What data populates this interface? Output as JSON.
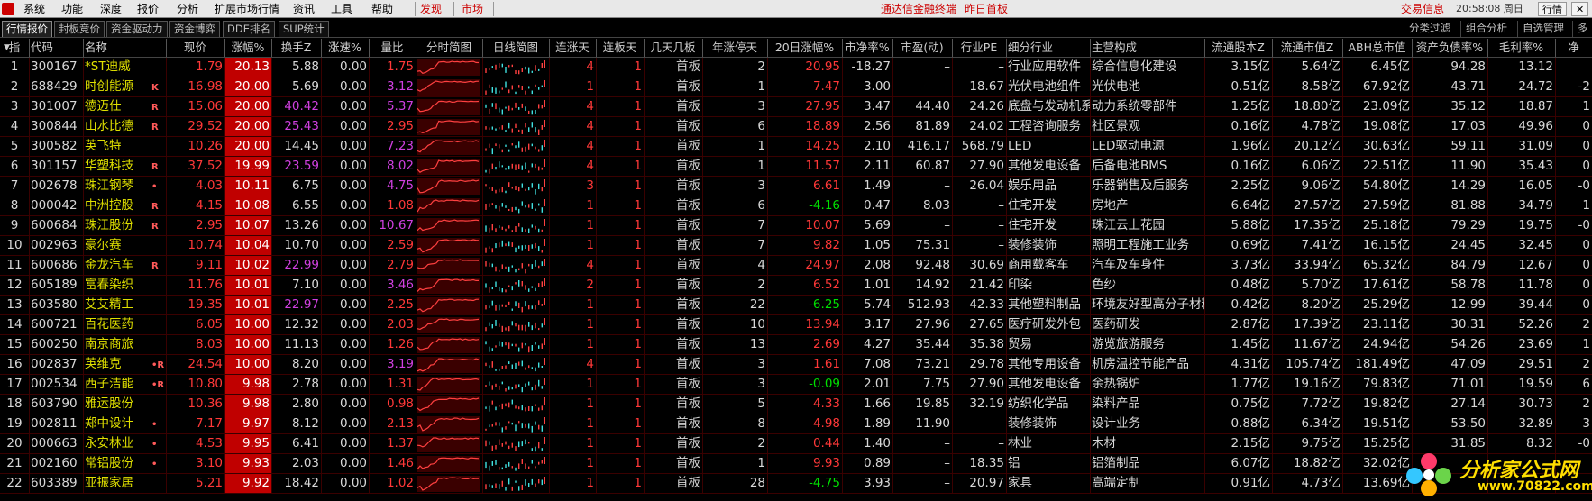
{
  "menu": {
    "items": [
      "系统",
      "功能",
      "深度",
      "报价",
      "分析",
      "扩展市场行情",
      "资讯",
      "工具",
      "帮助"
    ],
    "red_items": [
      "发现",
      "市场"
    ],
    "notice1": "通达信金融终端",
    "notice2": "昨日首板",
    "trade": "交易信息",
    "time": "20:58:08 周日",
    "btn_quote": "行情",
    "btn_close": "✕"
  },
  "tabs": [
    "行情报价",
    "封板竞价",
    "资金驱动力",
    "资金博弈",
    "DDE排名",
    "SUP统计"
  ],
  "right_tabs": [
    "分类过滤",
    "组合分析",
    "自选管理",
    "多"
  ],
  "columns": [
    "指",
    "代码",
    "名称",
    "现价",
    "涨幅%",
    "换手Z",
    "涨速%",
    "量比",
    "分时简图",
    "日线简图",
    "连涨天",
    "连板天",
    "几天几板",
    "年涨停天",
    "20日涨幅%",
    "市净率%",
    "市盈(动)",
    "行业PE",
    "细分行业",
    "主营构成",
    "流通股本Z",
    "流通市值Z",
    "ABH总市值",
    "资产负债率%",
    "毛利率%",
    "净"
  ],
  "rows": [
    {
      "n": "1",
      "code": "300167",
      "name": "*ST迪威",
      "flag": "",
      "price": "1.79",
      "pct": "20.13",
      "turn": "5.88",
      "spd": "0.00",
      "vr": "1.75",
      "ld": "4",
      "lb": "1",
      "board": "首板",
      "ytd": "2",
      "p20": "20.95",
      "p20c": "up",
      "pb": "-18.27",
      "pe": "–",
      "ipe": "–",
      "ind": "行业应用软件",
      "main": "综合信息化建设",
      "fs": "3.15亿",
      "fv": "5.64亿",
      "tv": "6.45亿",
      "dr": "94.28",
      "gm": "13.12",
      "x": ""
    },
    {
      "n": "2",
      "code": "688429",
      "name": "时创能源",
      "flag": "K",
      "price": "16.98",
      "pct": "20.00",
      "turn": "5.69",
      "spd": "0.00",
      "vr": "3.12",
      "ld": "1",
      "lb": "1",
      "board": "首板",
      "ytd": "1",
      "p20": "7.47",
      "p20c": "up",
      "pb": "3.00",
      "pe": "–",
      "ipe": "18.67",
      "ind": "光伏电池组件",
      "main": "光伏电池",
      "fs": "0.51亿",
      "fv": "8.58亿",
      "tv": "67.92亿",
      "dr": "43.71",
      "gm": "24.72",
      "x": "-2"
    },
    {
      "n": "3",
      "code": "301007",
      "name": "德迈仕",
      "flag": "R",
      "price": "15.06",
      "pct": "20.00",
      "turn": "40.42",
      "spd": "0.00",
      "vr": "5.37",
      "ld": "4",
      "lb": "1",
      "board": "首板",
      "ytd": "3",
      "p20": "27.95",
      "p20c": "up",
      "pb": "3.47",
      "pe": "44.40",
      "ipe": "24.26",
      "ind": "底盘与发动机系",
      "main": "动力系统零部件",
      "fs": "1.25亿",
      "fv": "18.80亿",
      "tv": "23.09亿",
      "dr": "35.12",
      "gm": "18.87",
      "x": "1"
    },
    {
      "n": "4",
      "code": "300844",
      "name": "山水比德",
      "flag": "R",
      "price": "29.52",
      "pct": "20.00",
      "turn": "25.43",
      "spd": "0.00",
      "vr": "2.95",
      "ld": "4",
      "lb": "1",
      "board": "首板",
      "ytd": "6",
      "p20": "18.89",
      "p20c": "up",
      "pb": "2.56",
      "pe": "81.89",
      "ipe": "24.02",
      "ind": "工程咨询服务",
      "main": "社区景观",
      "fs": "0.16亿",
      "fv": "4.78亿",
      "tv": "19.08亿",
      "dr": "17.03",
      "gm": "49.96",
      "x": "0"
    },
    {
      "n": "5",
      "code": "300582",
      "name": "英飞特",
      "flag": "",
      "price": "10.26",
      "pct": "20.00",
      "turn": "14.45",
      "spd": "0.00",
      "vr": "7.23",
      "ld": "4",
      "lb": "1",
      "board": "首板",
      "ytd": "1",
      "p20": "14.25",
      "p20c": "up",
      "pb": "2.10",
      "pe": "416.17",
      "ipe": "568.79",
      "ind": "LED",
      "main": "LED驱动电源",
      "fs": "1.96亿",
      "fv": "20.12亿",
      "tv": "30.63亿",
      "dr": "59.11",
      "gm": "31.09",
      "x": "0"
    },
    {
      "n": "6",
      "code": "301157",
      "name": "华塑科技",
      "flag": "R",
      "price": "37.52",
      "pct": "19.99",
      "turn": "23.59",
      "spd": "0.00",
      "vr": "8.02",
      "ld": "4",
      "lb": "1",
      "board": "首板",
      "ytd": "1",
      "p20": "11.57",
      "p20c": "up",
      "pb": "2.11",
      "pe": "60.87",
      "ipe": "27.90",
      "ind": "其他发电设备",
      "main": "后备电池BMS",
      "fs": "0.16亿",
      "fv": "6.06亿",
      "tv": "22.51亿",
      "dr": "11.90",
      "gm": "35.43",
      "x": "0"
    },
    {
      "n": "7",
      "code": "002678",
      "name": "珠江钢琴",
      "flag": "•",
      "price": "4.03",
      "pct": "10.11",
      "turn": "6.75",
      "spd": "0.00",
      "vr": "4.75",
      "ld": "3",
      "lb": "1",
      "board": "首板",
      "ytd": "3",
      "p20": "6.61",
      "p20c": "up",
      "pb": "1.49",
      "pe": "–",
      "ipe": "26.04",
      "ind": "娱乐用品",
      "main": "乐器销售及后服务",
      "fs": "2.25亿",
      "fv": "9.06亿",
      "tv": "54.80亿",
      "dr": "14.29",
      "gm": "16.05",
      "x": "-0"
    },
    {
      "n": "8",
      "code": "000042",
      "name": "中洲控股",
      "flag": "R",
      "price": "4.15",
      "pct": "10.08",
      "turn": "6.55",
      "spd": "0.00",
      "vr": "1.08",
      "ld": "1",
      "lb": "1",
      "board": "首板",
      "ytd": "6",
      "p20": "-4.16",
      "p20c": "dn",
      "pb": "0.47",
      "pe": "8.03",
      "ipe": "–",
      "ind": "住宅开发",
      "main": "房地产",
      "fs": "6.64亿",
      "fv": "27.57亿",
      "tv": "27.59亿",
      "dr": "81.88",
      "gm": "34.79",
      "x": "1"
    },
    {
      "n": "9",
      "code": "600684",
      "name": "珠江股份",
      "flag": "R",
      "price": "2.95",
      "pct": "10.07",
      "turn": "13.26",
      "spd": "0.00",
      "vr": "10.67",
      "ld": "1",
      "lb": "1",
      "board": "首板",
      "ytd": "7",
      "p20": "10.07",
      "p20c": "up",
      "pb": "5.69",
      "pe": "–",
      "ipe": "–",
      "ind": "住宅开发",
      "main": "珠江云上花园",
      "fs": "5.88亿",
      "fv": "17.35亿",
      "tv": "25.18亿",
      "dr": "79.29",
      "gm": "19.75",
      "x": "-0"
    },
    {
      "n": "10",
      "code": "002963",
      "name": "豪尔赛",
      "flag": "",
      "price": "10.74",
      "pct": "10.04",
      "turn": "10.70",
      "spd": "0.00",
      "vr": "2.59",
      "ld": "1",
      "lb": "1",
      "board": "首板",
      "ytd": "7",
      "p20": "9.82",
      "p20c": "up",
      "pb": "1.05",
      "pe": "75.31",
      "ipe": "–",
      "ind": "装修装饰",
      "main": "照明工程施工业务",
      "fs": "0.69亿",
      "fv": "7.41亿",
      "tv": "16.15亿",
      "dr": "24.45",
      "gm": "32.45",
      "x": "0"
    },
    {
      "n": "11",
      "code": "600686",
      "name": "金龙汽车",
      "flag": "R",
      "price": "9.11",
      "pct": "10.02",
      "turn": "22.99",
      "spd": "0.00",
      "vr": "2.79",
      "ld": "4",
      "lb": "1",
      "board": "首板",
      "ytd": "4",
      "p20": "24.97",
      "p20c": "up",
      "pb": "2.08",
      "pe": "92.48",
      "ipe": "30.69",
      "ind": "商用载客车",
      "main": "汽车及车身件",
      "fs": "3.73亿",
      "fv": "33.94亿",
      "tv": "65.32亿",
      "dr": "84.79",
      "gm": "12.67",
      "x": "0"
    },
    {
      "n": "12",
      "code": "605189",
      "name": "富春染织",
      "flag": "",
      "price": "11.76",
      "pct": "10.01",
      "turn": "7.10",
      "spd": "0.00",
      "vr": "3.46",
      "ld": "2",
      "lb": "1",
      "board": "首板",
      "ytd": "2",
      "p20": "6.52",
      "p20c": "up",
      "pb": "1.01",
      "pe": "14.92",
      "ipe": "21.42",
      "ind": "印染",
      "main": "色纱",
      "fs": "0.48亿",
      "fv": "5.70亿",
      "tv": "17.61亿",
      "dr": "58.78",
      "gm": "11.78",
      "x": "0"
    },
    {
      "n": "13",
      "code": "603580",
      "name": "艾艾精工",
      "flag": "",
      "price": "19.35",
      "pct": "10.01",
      "turn": "22.97",
      "spd": "0.00",
      "vr": "2.25",
      "ld": "1",
      "lb": "1",
      "board": "首板",
      "ytd": "22",
      "p20": "-6.25",
      "p20c": "dn",
      "pb": "5.74",
      "pe": "512.93",
      "ipe": "42.33",
      "ind": "其他塑料制品",
      "main": "环境友好型高分子材料",
      "fs": "0.42亿",
      "fv": "8.20亿",
      "tv": "25.29亿",
      "dr": "12.99",
      "gm": "39.44",
      "x": "0"
    },
    {
      "n": "14",
      "code": "600721",
      "name": "百花医药",
      "flag": "",
      "price": "6.05",
      "pct": "10.00",
      "turn": "12.32",
      "spd": "0.00",
      "vr": "2.03",
      "ld": "1",
      "lb": "1",
      "board": "首板",
      "ytd": "10",
      "p20": "13.94",
      "p20c": "up",
      "pb": "3.17",
      "pe": "27.96",
      "ipe": "27.65",
      "ind": "医疗研发外包",
      "main": "医药研发",
      "fs": "2.87亿",
      "fv": "17.39亿",
      "tv": "23.11亿",
      "dr": "30.31",
      "gm": "52.26",
      "x": "2"
    },
    {
      "n": "15",
      "code": "600250",
      "name": "南京商旅",
      "flag": "",
      "price": "8.03",
      "pct": "10.00",
      "turn": "11.13",
      "spd": "0.00",
      "vr": "1.26",
      "ld": "1",
      "lb": "1",
      "board": "首板",
      "ytd": "13",
      "p20": "2.69",
      "p20c": "up",
      "pb": "4.27",
      "pe": "35.44",
      "ipe": "35.38",
      "ind": "贸易",
      "main": "游览旅游服务",
      "fs": "1.45亿",
      "fv": "11.67亿",
      "tv": "24.94亿",
      "dr": "54.26",
      "gm": "23.69",
      "x": "1"
    },
    {
      "n": "16",
      "code": "002837",
      "name": "英维克",
      "flag": "•R",
      "price": "24.54",
      "pct": "10.00",
      "turn": "8.20",
      "spd": "0.00",
      "vr": "3.19",
      "ld": "4",
      "lb": "1",
      "board": "首板",
      "ytd": "3",
      "p20": "1.61",
      "p20c": "up",
      "pb": "7.08",
      "pe": "73.21",
      "ipe": "29.78",
      "ind": "其他专用设备",
      "main": "机房温控节能产品",
      "fs": "4.31亿",
      "fv": "105.74亿",
      "tv": "181.49亿",
      "dr": "47.09",
      "gm": "29.51",
      "x": "2"
    },
    {
      "n": "17",
      "code": "002534",
      "name": "西子洁能",
      "flag": "•R",
      "price": "10.80",
      "pct": "9.98",
      "turn": "2.78",
      "spd": "0.00",
      "vr": "1.31",
      "ld": "1",
      "lb": "1",
      "board": "首板",
      "ytd": "3",
      "p20": "-0.09",
      "p20c": "dn",
      "pb": "2.01",
      "pe": "7.75",
      "ipe": "27.90",
      "ind": "其他发电设备",
      "main": "余热锅炉",
      "fs": "1.77亿",
      "fv": "19.16亿",
      "tv": "79.83亿",
      "dr": "71.01",
      "gm": "19.59",
      "x": "6"
    },
    {
      "n": "18",
      "code": "603790",
      "name": "雅运股份",
      "flag": "",
      "price": "10.36",
      "pct": "9.98",
      "turn": "2.80",
      "spd": "0.00",
      "vr": "0.98",
      "ld": "1",
      "lb": "1",
      "board": "首板",
      "ytd": "5",
      "p20": "4.33",
      "p20c": "up",
      "pb": "1.66",
      "pe": "19.85",
      "ipe": "32.19",
      "ind": "纺织化学品",
      "main": "染料产品",
      "fs": "0.75亿",
      "fv": "7.72亿",
      "tv": "19.82亿",
      "dr": "27.14",
      "gm": "30.73",
      "x": "2"
    },
    {
      "n": "19",
      "code": "002811",
      "name": "郑中设计",
      "flag": "•",
      "price": "7.17",
      "pct": "9.97",
      "turn": "8.12",
      "spd": "0.00",
      "vr": "2.13",
      "ld": "1",
      "lb": "1",
      "board": "首板",
      "ytd": "8",
      "p20": "4.98",
      "p20c": "up",
      "pb": "1.89",
      "pe": "11.90",
      "ipe": "–",
      "ind": "装修装饰",
      "main": "设计业务",
      "fs": "0.88亿",
      "fv": "6.34亿",
      "tv": "19.51亿",
      "dr": "53.50",
      "gm": "32.89",
      "x": "3"
    },
    {
      "n": "20",
      "code": "000663",
      "name": "永安林业",
      "flag": "•",
      "price": "4.53",
      "pct": "9.95",
      "turn": "6.41",
      "spd": "0.00",
      "vr": "1.37",
      "ld": "1",
      "lb": "1",
      "board": "首板",
      "ytd": "2",
      "p20": "0.44",
      "p20c": "up",
      "pb": "1.40",
      "pe": "–",
      "ipe": "–",
      "ind": "林业",
      "main": "木材",
      "fs": "2.15亿",
      "fv": "9.75亿",
      "tv": "15.25亿",
      "dr": "31.85",
      "gm": "8.32",
      "x": "-0"
    },
    {
      "n": "21",
      "code": "002160",
      "name": "常铝股份",
      "flag": "•",
      "price": "3.10",
      "pct": "9.93",
      "turn": "2.03",
      "spd": "0.00",
      "vr": "1.46",
      "ld": "1",
      "lb": "1",
      "board": "首板",
      "ytd": "1",
      "p20": "9.93",
      "p20c": "up",
      "pb": "0.89",
      "pe": "–",
      "ipe": "18.35",
      "ind": "铝",
      "main": "铝箔制品",
      "fs": "6.07亿",
      "fv": "18.82亿",
      "tv": "32.02亿",
      "dr": "",
      "gm": "",
      "x": ""
    },
    {
      "n": "22",
      "code": "603389",
      "name": "亚振家居",
      "flag": "",
      "price": "5.21",
      "pct": "9.92",
      "turn": "18.42",
      "spd": "0.00",
      "vr": "1.02",
      "ld": "1",
      "lb": "1",
      "board": "首板",
      "ytd": "28",
      "p20": "-4.75",
      "p20c": "dn",
      "pb": "3.93",
      "pe": "–",
      "ipe": "20.97",
      "ind": "家具",
      "main": "高端定制",
      "fs": "0.91亿",
      "fv": "4.73亿",
      "tv": "13.69亿",
      "dr": "",
      "gm": "",
      "x": ""
    }
  ],
  "logo": {
    "title": "分析家公式网",
    "url": "www.70822.com"
  },
  "colors": {
    "up": "#ff3838",
    "down": "#00e000",
    "pct_bg": "#c00000",
    "turnover": "#d040e0",
    "vr_bright": "#d040e0"
  }
}
